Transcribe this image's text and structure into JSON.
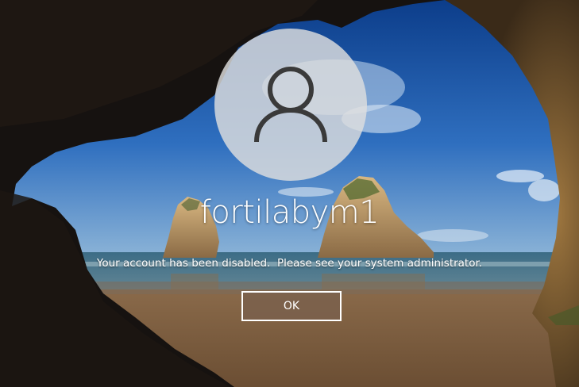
{
  "lock_screen": {
    "username": "fortilabym1",
    "message": "Your account has been disabled.  Please see your system administrator.",
    "ok_label": "OK"
  },
  "icons": {
    "avatar": "user-silhouette-icon"
  },
  "colors": {
    "avatar_background": "#dedede",
    "icon_stroke": "#3a3a3a",
    "text": "#ffffff",
    "button_border": "#ffffff",
    "button_fill": "#78604e"
  }
}
